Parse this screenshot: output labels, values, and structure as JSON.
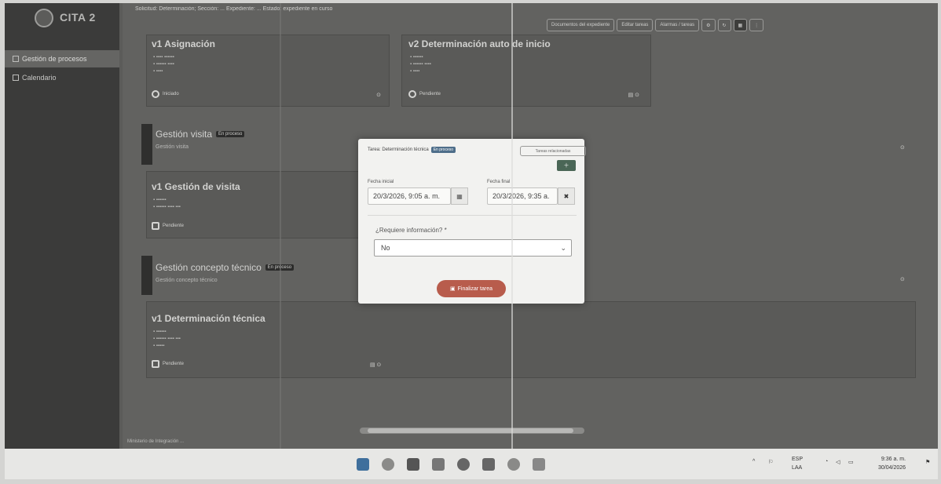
{
  "app": {
    "title": "CITA 2"
  },
  "sidebar": {
    "items": [
      {
        "label": "Gestión de procesos"
      },
      {
        "label": "Calendario"
      }
    ]
  },
  "topbar": {
    "info": "Solicitud: Determinación; Sección: ...  Expediente: ...  Estado: expediente en curso",
    "buttons": [
      "Documentos del expediente",
      "Editar tareas",
      "Alarmas / tareas"
    ]
  },
  "cards": {
    "asignacion": {
      "title": "v1 Asignación",
      "state": "Iniciado"
    },
    "determinacion_auto": {
      "title": "v2 Determinación auto de inicio",
      "state": "Pendiente"
    },
    "gestion_visita_group": {
      "title": "Gestión visita",
      "badge": "En proceso",
      "sub": "Gestión visita"
    },
    "gestion_de_visita": {
      "title": "v1 Gestión de visita",
      "state": "Pendiente"
    },
    "concepto_group": {
      "title": "Gestión concepto técnico",
      "badge": "En proceso",
      "sub": "Gestión concepto técnico"
    },
    "determinacion_tecnica": {
      "title": "v1 Determinación técnica",
      "state": "Pendiente"
    }
  },
  "footer": {
    "text": "Ministerio de Integración ..."
  },
  "modal": {
    "task_label": "Tarea: Determinación técnica",
    "task_badge": "En proceso",
    "top_button": "Tareas relacionadas",
    "start_label": "Fecha inicial",
    "start_value": "20/3/2026, 9:05 a. m.",
    "end_label": "Fecha final",
    "end_value": "20/3/2026, 9:35 a.",
    "question": "¿Requiere información? *",
    "select_value": "No",
    "finish_button": "Finalizar tarea"
  },
  "taskbar": {
    "lang_top": "ESP",
    "lang_bottom": "LAA",
    "time": "9:36 a. m.",
    "date": "30/04/2026"
  }
}
